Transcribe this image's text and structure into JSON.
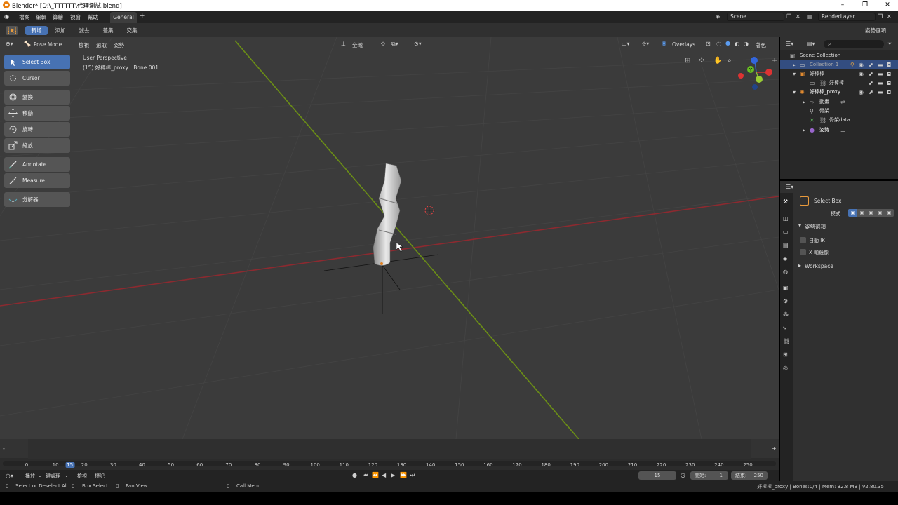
{
  "window": {
    "title": "Blender* [D:\\_TTTTTT\\代理測試.blend]",
    "minimize": "–",
    "maximize": "❐",
    "close": "✕"
  },
  "menu": {
    "items": [
      "檔案",
      "編輯",
      "算繪",
      "視窗",
      "幫助"
    ],
    "workspace_tab": "General",
    "add_tab": "+",
    "scene": "Scene",
    "view_layer": "RenderLayer"
  },
  "tool_header": {
    "modes": [
      "新增",
      "添加",
      "減去",
      "差集",
      "交集"
    ],
    "pose_options": "姿勢選項"
  },
  "viewport_header": {
    "mode": "Pose Mode",
    "menus": [
      "檢視",
      "選取",
      "姿勢"
    ],
    "transform_orientation": "全域",
    "overlays": "Overlays",
    "shading": "著色"
  },
  "viewport": {
    "perspective_label": "User Perspective",
    "active_object_label": "(15) 好棒棒_proxy : Bone.001"
  },
  "gizmo": {
    "y_label": "Y"
  },
  "toolbar": {
    "tools": [
      {
        "label": "Select Box",
        "icon": "select-box-icon",
        "active": true
      },
      {
        "label": "Cursor",
        "icon": "cursor-icon",
        "active": false
      },
      {
        "label": "變換",
        "icon": "transform-icon",
        "active": false
      },
      {
        "label": "移動",
        "icon": "move-icon",
        "active": false
      },
      {
        "label": "旋轉",
        "icon": "rotate-icon",
        "active": false
      },
      {
        "label": "縮放",
        "icon": "scale-icon",
        "active": false
      },
      {
        "label": "Annotate",
        "icon": "annotate-icon",
        "active": false
      },
      {
        "label": "Measure",
        "icon": "measure-icon",
        "active": false
      },
      {
        "label": "分解器",
        "icon": "breakdowner-icon",
        "active": false
      }
    ]
  },
  "outliner": {
    "rows": [
      {
        "label": "Scene Collection",
        "indent": 0,
        "selected": false
      },
      {
        "label": "Collection 1",
        "indent": 1,
        "selected": true
      },
      {
        "label": "好棒棒",
        "indent": 1,
        "selected": false
      },
      {
        "label": "好棒棒",
        "indent": 3,
        "selected": false
      },
      {
        "label": "好棒棒_proxy",
        "indent": 1,
        "selected": false
      },
      {
        "label": "動畫",
        "indent": 2,
        "selected": false
      },
      {
        "label": "骨架",
        "indent": 2,
        "selected": false
      },
      {
        "label": "骨架data",
        "indent": 3,
        "selected": false
      },
      {
        "label": "姿勢",
        "indent": 2,
        "selected": false
      }
    ]
  },
  "properties": {
    "tool_name": "Select Box",
    "mode_label": "模式",
    "pose_options_header": "姿勢選項",
    "auto_ik": "自動 IK",
    "x_mirror": "X 軸鏡像",
    "workspace_header": "Workspace"
  },
  "timeline": {
    "current_frame": "15",
    "ticks": [
      "0",
      "10",
      "15",
      "20",
      "30",
      "40",
      "50",
      "60",
      "70",
      "80",
      "90",
      "100",
      "110",
      "120",
      "130",
      "140",
      "150",
      "160",
      "170",
      "180",
      "190",
      "200",
      "210",
      "220",
      "230",
      "240",
      "250"
    ],
    "menus": [
      "播放",
      "鍵處理",
      "檢視",
      "標記"
    ],
    "start_label": "開始:",
    "start_value": "1",
    "end_label": "結束:",
    "end_value": "250"
  },
  "status": {
    "select": "Select or Deselect All",
    "box_select": "Box Select",
    "pan_view": "Pan View",
    "call_menu": "Call Menu",
    "info": "好棒棒_proxy | Bones:0/4 | Mem: 32.8 MB | v2.80.35"
  }
}
